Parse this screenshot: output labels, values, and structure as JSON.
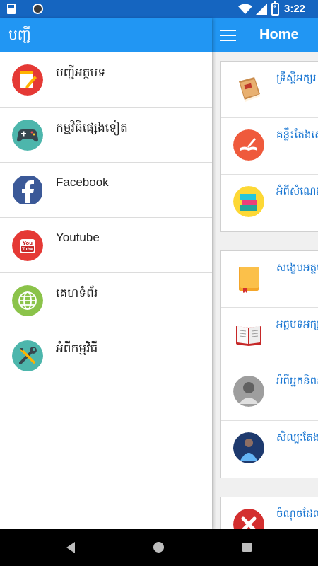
{
  "status_bar": {
    "time": "3:22"
  },
  "main": {
    "title": "Home",
    "card1": [
      {
        "label": "ទ្រឹស្ដីអក្សរ",
        "icon": "book-icon"
      },
      {
        "label": "គន្លឹះតែងសេចក្ដី",
        "icon": "pen-book-icon"
      },
      {
        "label": "អំពីសំណេរ",
        "icon": "books-icon"
      }
    ],
    "card2": [
      {
        "label": "សង្ខេបអត្ថបទ",
        "icon": "closed-book-icon"
      },
      {
        "label": "អត្ថបទអក្សរ",
        "icon": "open-book-icon"
      },
      {
        "label": "អំពីអ្នកនិពន្ធ",
        "icon": "author-photo"
      },
      {
        "label": "សិល្បៈតែង",
        "icon": "artist-photo"
      }
    ],
    "card3": [
      {
        "label": "ចំណុចដែល",
        "icon": "close-icon"
      }
    ]
  },
  "drawer": {
    "title": "បញ្ជី",
    "items": [
      {
        "label": "បញ្ជីអត្ថបទ",
        "icon": "notepad-pen-icon"
      },
      {
        "label": "កម្មវិធីផ្សេងទៀត",
        "icon": "gamepad-icon"
      },
      {
        "label": "Facebook",
        "icon": "facebook-icon"
      },
      {
        "label": "Youtube",
        "icon": "youtube-icon"
      },
      {
        "label": "គេហទំព័រ",
        "icon": "globe-icon"
      },
      {
        "label": "អំពីកម្មវិធី",
        "icon": "tools-icon"
      }
    ]
  },
  "colors": {
    "primary": "#2196f3",
    "status_bar": "#1565c0",
    "link_text": "#1976d2"
  }
}
